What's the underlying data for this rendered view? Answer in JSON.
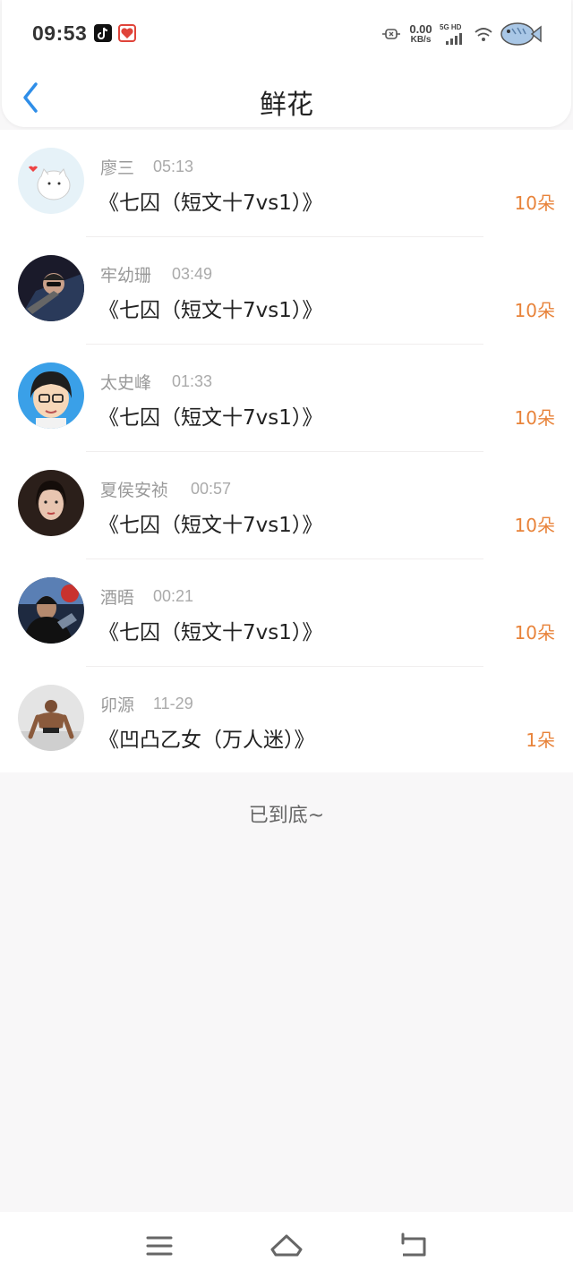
{
  "status_bar": {
    "time": "09:53",
    "net_speed_value": "0.00",
    "net_speed_unit": "KB/s",
    "network_label": "5G HD"
  },
  "header": {
    "title": "鲜花"
  },
  "flower_list": [
    {
      "user": "廖三",
      "time": "05:13",
      "book": "《七囚（短文十7vs1）》",
      "count": "10朵"
    },
    {
      "user": "牢幼珊",
      "time": "03:49",
      "book": "《七囚（短文十7vs1）》",
      "count": "10朵"
    },
    {
      "user": "太史峰",
      "time": "01:33",
      "book": "《七囚（短文十7vs1）》",
      "count": "10朵"
    },
    {
      "user": "夏侯安祯",
      "time": "00:57",
      "book": "《七囚（短文十7vs1）》",
      "count": "10朵"
    },
    {
      "user": "酒晤",
      "time": "00:21",
      "book": "《七囚（短文十7vs1）》",
      "count": "10朵"
    },
    {
      "user": "卯源",
      "time": "11-29",
      "book": "《凹凸乙女（万人迷）》",
      "count": "1朵"
    }
  ],
  "footer": {
    "end_text": "已到底~"
  },
  "colors": {
    "accent_blue": "#2f8ee8",
    "flower_count_orange": "#e8833a",
    "page_background": "#f8f7f8"
  }
}
